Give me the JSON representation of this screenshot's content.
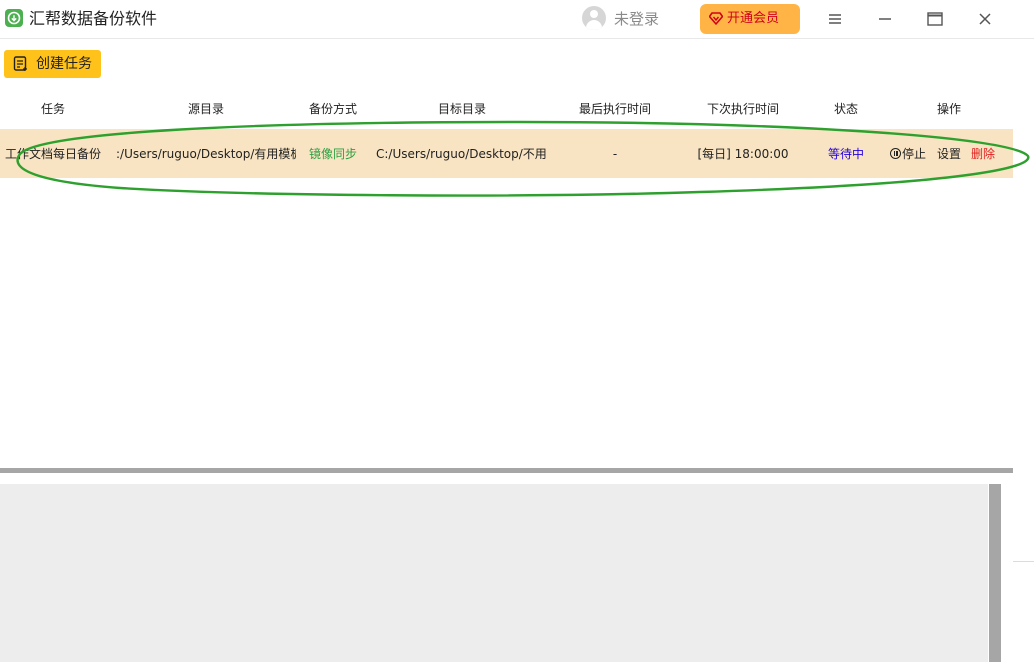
{
  "app": {
    "title": "汇帮数据备份软件",
    "accent": "#4caf50"
  },
  "header": {
    "login_text": "未登录",
    "vip_label": "开通会员",
    "vip_color": "#ffb445"
  },
  "toolbar": {
    "create_label": "创建任务"
  },
  "table": {
    "columns": [
      "任务",
      "源目录",
      "备份方式",
      "目标目录",
      "最后执行时间",
      "下次执行时间",
      "状态",
      "操作"
    ],
    "rows": [
      {
        "task": "工作文档每日备份",
        "source": ":/Users/ruguo/Desktop/有用模板",
        "mode": "镜像同步",
        "target": "C:/Users/ruguo/Desktop/不用",
        "last_run": "-",
        "next_run": "[每日] 18:00:00",
        "status": "等待中",
        "actions": {
          "stop": "停止",
          "settings": "设置",
          "delete": "删除"
        }
      }
    ]
  }
}
